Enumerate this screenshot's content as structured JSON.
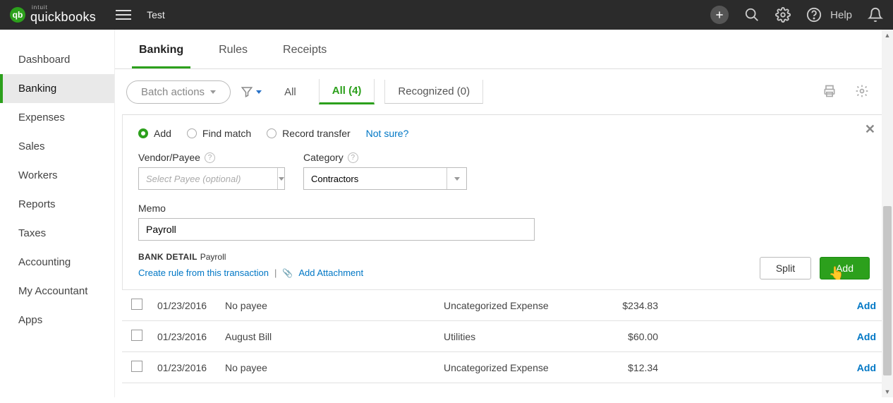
{
  "header": {
    "brand_small": "intuit",
    "brand": "quickbooks",
    "company": "Test",
    "help_label": "Help"
  },
  "sidebar": {
    "items": [
      {
        "label": "Dashboard"
      },
      {
        "label": "Banking"
      },
      {
        "label": "Expenses"
      },
      {
        "label": "Sales"
      },
      {
        "label": "Workers"
      },
      {
        "label": "Reports"
      },
      {
        "label": "Taxes"
      },
      {
        "label": "Accounting"
      },
      {
        "label": "My Accountant"
      },
      {
        "label": "Apps"
      }
    ],
    "active_index": 1
  },
  "tabs": {
    "items": [
      {
        "label": "Banking"
      },
      {
        "label": "Rules"
      },
      {
        "label": "Receipts"
      }
    ],
    "active_index": 0
  },
  "toolbar": {
    "batch_label": "Batch actions",
    "filters": {
      "all_label": "All",
      "all_count_label": "All (4)",
      "recognized_label": "Recognized (0)"
    }
  },
  "panel": {
    "radios": {
      "add": "Add",
      "find_match": "Find match",
      "record_transfer": "Record transfer",
      "not_sure": "Not sure?"
    },
    "vendor_label": "Vendor/Payee",
    "vendor_placeholder": "Select Payee (optional)",
    "category_label": "Category",
    "category_value": "Contractors",
    "memo_label": "Memo",
    "memo_value": "Payroll",
    "bank_detail_label": "BANK DETAIL",
    "bank_detail_value": "Payroll",
    "create_rule": "Create rule from this transaction",
    "add_attachment": "Add Attachment",
    "split_btn": "Split",
    "add_btn": "Add"
  },
  "transactions": [
    {
      "date": "01/23/2016",
      "payee": "No payee",
      "category": "Uncategorized Expense",
      "amount": "$234.83",
      "action": "Add"
    },
    {
      "date": "01/23/2016",
      "payee": "August Bill",
      "category": "Utilities",
      "amount": "$60.00",
      "action": "Add"
    },
    {
      "date": "01/23/2016",
      "payee": "No payee",
      "category": "Uncategorized Expense",
      "amount": "$12.34",
      "action": "Add"
    }
  ]
}
